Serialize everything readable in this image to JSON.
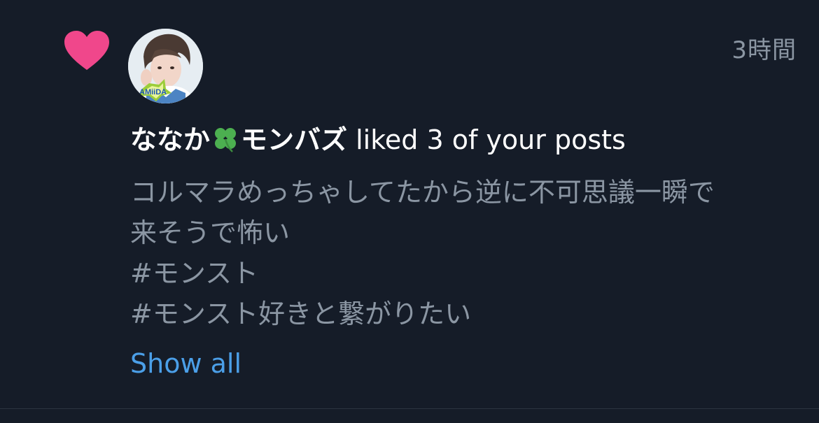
{
  "notification": {
    "timestamp": "3時間",
    "user_name_prefix": "ななか",
    "user_name_suffix": "モンバズ",
    "action_text": "liked 3 of your posts",
    "post_lines": [
      "コルマラめっちゃしてたから逆に不可思議一瞬で",
      "来そうで怖い",
      "#モンスト",
      "#モンスト好きと繋がりたい"
    ],
    "show_all_label": "Show all",
    "avatar_badge_text": "AMiiDA",
    "icons": {
      "like": "heart-icon",
      "name_emoji": "four-leaf-clover-icon"
    },
    "colors": {
      "background": "#151c28",
      "heart": "#f0478b",
      "secondary_text": "#8b96a3",
      "link": "#4b9fe8",
      "clover": "#4caf50"
    }
  }
}
